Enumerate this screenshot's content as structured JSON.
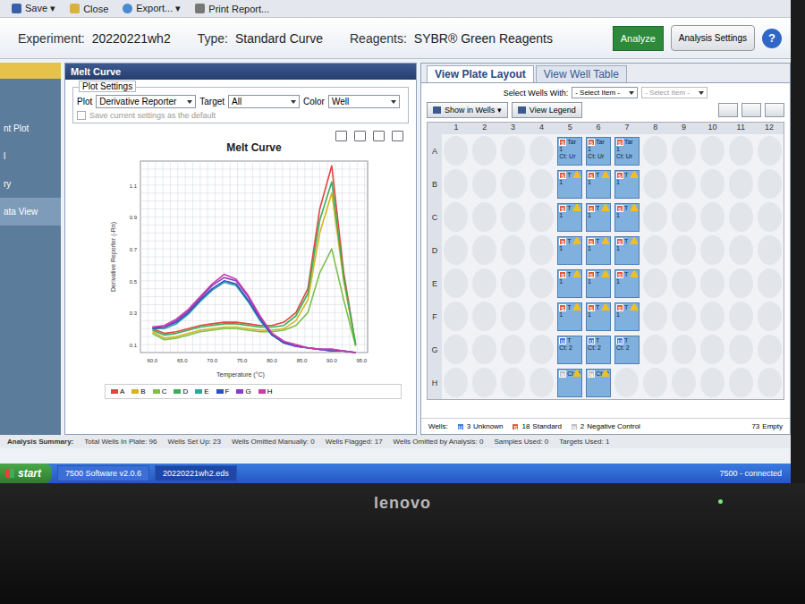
{
  "toolbar": [
    "Save ▾",
    "Close",
    "Export... ▾",
    "Print Report..."
  ],
  "header": {
    "experiment_label": "Experiment:",
    "experiment": "20220221wh2",
    "type_label": "Type:",
    "type": "Standard Curve",
    "reagents_label": "Reagents:",
    "reagents": "SYBR® Green Reagents",
    "analyze": "Analyze",
    "settings": "Analysis Settings",
    "help": "?"
  },
  "sidebar": {
    "items": [
      {
        "label": "nt Plot",
        "selected": false
      },
      {
        "label": "l",
        "selected": false
      },
      {
        "label": "ry",
        "selected": false
      },
      {
        "label": "ata View",
        "selected": true
      }
    ]
  },
  "melt": {
    "panel_title": "Melt Curve",
    "settings_tab": "Plot Settings",
    "plot_label": "Plot",
    "plot": "Derivative Reporter",
    "target_label": "Target",
    "target": "All",
    "color_label": "Color",
    "color": "Well",
    "save_default": {
      "label": "Save current settings as the default",
      "checked": false,
      "disabled": true
    },
    "chart": {
      "title": "Melt Curve",
      "y_label": "Derivative Reporter (-Rn)",
      "x_label": "Temperature (°C)",
      "y_ticks": [
        "0.1",
        "0.3",
        "0.5",
        "0.7",
        "0.9",
        "1.1"
      ],
      "x_ticks": [
        "60.0",
        "65.0",
        "70.0",
        "75.0",
        "80.0",
        "85.0",
        "90.0",
        "95.0"
      ],
      "x_range": [
        58,
        96
      ],
      "y_range": [
        0.05,
        1.25
      ],
      "temperatures": [
        60,
        62,
        64,
        66,
        68,
        70,
        72,
        74,
        76,
        78,
        80,
        82,
        84,
        86,
        88,
        90,
        92,
        94
      ],
      "series": [
        {
          "name": "A",
          "color": "#e0463c",
          "values": [
            0.2,
            0.17,
            0.18,
            0.2,
            0.22,
            0.23,
            0.24,
            0.24,
            0.23,
            0.22,
            0.22,
            0.24,
            0.3,
            0.45,
            0.95,
            1.22,
            0.55,
            0.1
          ]
        },
        {
          "name": "B",
          "color": "#d8b41c",
          "values": [
            0.18,
            0.14,
            0.15,
            0.17,
            0.19,
            0.2,
            0.21,
            0.21,
            0.2,
            0.19,
            0.19,
            0.2,
            0.25,
            0.38,
            0.8,
            1.05,
            0.5,
            0.1
          ]
        },
        {
          "name": "C",
          "color": "#7cc04a",
          "values": [
            0.17,
            0.13,
            0.14,
            0.16,
            0.18,
            0.19,
            0.2,
            0.2,
            0.19,
            0.18,
            0.18,
            0.19,
            0.22,
            0.3,
            0.55,
            0.7,
            0.38,
            0.09
          ]
        },
        {
          "name": "D",
          "color": "#3cae5a",
          "values": [
            0.19,
            0.16,
            0.17,
            0.19,
            0.21,
            0.22,
            0.23,
            0.23,
            0.22,
            0.21,
            0.21,
            0.22,
            0.28,
            0.42,
            0.88,
            1.12,
            0.52,
            0.1
          ]
        },
        {
          "name": "E",
          "color": "#2aa8a0",
          "values": [
            0.2,
            0.2,
            0.23,
            0.29,
            0.37,
            0.44,
            0.49,
            0.47,
            0.37,
            0.25,
            0.16,
            0.11,
            0.09,
            0.08,
            0.07,
            0.06,
            0.06,
            0.05
          ]
        },
        {
          "name": "F",
          "color": "#2d4fc4",
          "values": [
            0.2,
            0.21,
            0.24,
            0.3,
            0.38,
            0.45,
            0.5,
            0.48,
            0.38,
            0.26,
            0.16,
            0.11,
            0.09,
            0.08,
            0.07,
            0.06,
            0.06,
            0.05
          ]
        },
        {
          "name": "G",
          "color": "#8a3cc4",
          "values": [
            0.21,
            0.21,
            0.25,
            0.31,
            0.39,
            0.47,
            0.52,
            0.5,
            0.4,
            0.27,
            0.17,
            0.12,
            0.09,
            0.08,
            0.07,
            0.07,
            0.06,
            0.05
          ]
        },
        {
          "name": "H",
          "color": "#c83ca8",
          "values": [
            0.21,
            0.22,
            0.26,
            0.32,
            0.4,
            0.48,
            0.54,
            0.51,
            0.41,
            0.28,
            0.17,
            0.12,
            0.1,
            0.08,
            0.07,
            0.07,
            0.06,
            0.05
          ]
        }
      ]
    }
  },
  "plate": {
    "tabs": [
      {
        "label": "View Plate Layout",
        "selected": true
      },
      {
        "label": "View Well Table",
        "selected": false
      }
    ],
    "select_label": "Select Wells With:",
    "selects": [
      "- Select Item -",
      "- Select Item -"
    ],
    "buttons": [
      "Show in Wells ▾",
      "View Legend"
    ],
    "columns": [
      "1",
      "2",
      "3",
      "4",
      "5",
      "6",
      "7",
      "8",
      "9",
      "10",
      "11",
      "12"
    ],
    "rows": [
      "A",
      "B",
      "C",
      "D",
      "E",
      "F",
      "G",
      "H"
    ],
    "flag_mark": "!",
    "wells": [
      {
        "row": "A",
        "col": "5",
        "kind": "standard",
        "flagged": false,
        "lines": [
          "Tar",
          "1",
          "Ct: Ur"
        ]
      },
      {
        "row": "A",
        "col": "6",
        "kind": "standard",
        "flagged": false,
        "lines": [
          "Tar",
          "1",
          "Ct: Ur"
        ]
      },
      {
        "row": "A",
        "col": "7",
        "kind": "standard",
        "flagged": false,
        "lines": [
          "Tar",
          "1",
          "Ct: Ur"
        ]
      },
      {
        "row": "B",
        "col": "5",
        "kind": "standard",
        "flagged": true,
        "lines": [
          "T",
          "1"
        ]
      },
      {
        "row": "B",
        "col": "6",
        "kind": "standard",
        "flagged": true,
        "lines": [
          "T",
          "1"
        ]
      },
      {
        "row": "B",
        "col": "7",
        "kind": "standard",
        "flagged": true,
        "lines": [
          "T",
          "1"
        ]
      },
      {
        "row": "C",
        "col": "5",
        "kind": "standard",
        "flagged": true,
        "lines": [
          "T",
          "1"
        ]
      },
      {
        "row": "C",
        "col": "6",
        "kind": "standard",
        "flagged": true,
        "lines": [
          "T",
          "1"
        ]
      },
      {
        "row": "C",
        "col": "7",
        "kind": "standard",
        "flagged": true,
        "lines": [
          "T",
          "1"
        ]
      },
      {
        "row": "D",
        "col": "5",
        "kind": "standard",
        "flagged": true,
        "lines": [
          "T",
          "1"
        ]
      },
      {
        "row": "D",
        "col": "6",
        "kind": "standard",
        "flagged": true,
        "lines": [
          "T",
          "1"
        ]
      },
      {
        "row": "D",
        "col": "7",
        "kind": "standard",
        "flagged": true,
        "lines": [
          "T",
          "1"
        ]
      },
      {
        "row": "E",
        "col": "5",
        "kind": "standard",
        "flagged": true,
        "lines": [
          "T",
          "1"
        ]
      },
      {
        "row": "E",
        "col": "6",
        "kind": "standard",
        "flagged": true,
        "lines": [
          "T",
          "1"
        ]
      },
      {
        "row": "E",
        "col": "7",
        "kind": "standard",
        "flagged": true,
        "lines": [
          "T",
          "1"
        ]
      },
      {
        "row": "F",
        "col": "5",
        "kind": "standard",
        "flagged": true,
        "lines": [
          "T",
          "1"
        ]
      },
      {
        "row": "F",
        "col": "6",
        "kind": "standard",
        "flagged": true,
        "lines": [
          "T",
          "1"
        ]
      },
      {
        "row": "F",
        "col": "7",
        "kind": "standard",
        "flagged": true,
        "lines": [
          "T",
          "1"
        ]
      },
      {
        "row": "G",
        "col": "5",
        "kind": "unknown",
        "flagged": false,
        "lines": [
          "T",
          "Ct: 2"
        ]
      },
      {
        "row": "G",
        "col": "6",
        "kind": "unknown",
        "flagged": false,
        "lines": [
          "T",
          "Ct: 2"
        ]
      },
      {
        "row": "G",
        "col": "7",
        "kind": "unknown",
        "flagged": false,
        "lines": [
          "T",
          "Ct: 2"
        ]
      },
      {
        "row": "H",
        "col": "5",
        "kind": "negative",
        "flagged": true,
        "lines": [
          "Ct: 2"
        ]
      },
      {
        "row": "H",
        "col": "6",
        "kind": "negative",
        "flagged": true,
        "lines": [
          "Ct: 2"
        ]
      }
    ],
    "legend_label": "Wells:",
    "legend": [
      {
        "kind": "unknown",
        "icon": "U",
        "count": "3",
        "label": "Unknown",
        "color": "#3c78d8"
      },
      {
        "kind": "standard",
        "icon": "S",
        "count": "18",
        "label": "Standard",
        "color": "#e05a3a"
      },
      {
        "kind": "negative",
        "icon": "N",
        "count": "2",
        "label": "Negative Control",
        "color": "#b8bcc4"
      }
    ],
    "empty": {
      "count": "73",
      "label": "Empty"
    }
  },
  "summary": {
    "title": "Analysis Summary:",
    "items": [
      "Total Wells In Plate: 96",
      "Wells Set Up: 23",
      "Wells Omitted Manually: 0",
      "Wells Flagged: 17",
      "Wells Omitted by Analysis: 0",
      "Samples Used: 0",
      "Targets Used: 1"
    ]
  },
  "taskbar": {
    "start": "start",
    "items": [
      {
        "label": "7500 Software v2.0.6",
        "selected": false
      },
      {
        "label": "20220221wh2.eds",
        "selected": true
      }
    ],
    "status": "7500 - connected"
  },
  "monitor": {
    "brand": "lenovo"
  }
}
